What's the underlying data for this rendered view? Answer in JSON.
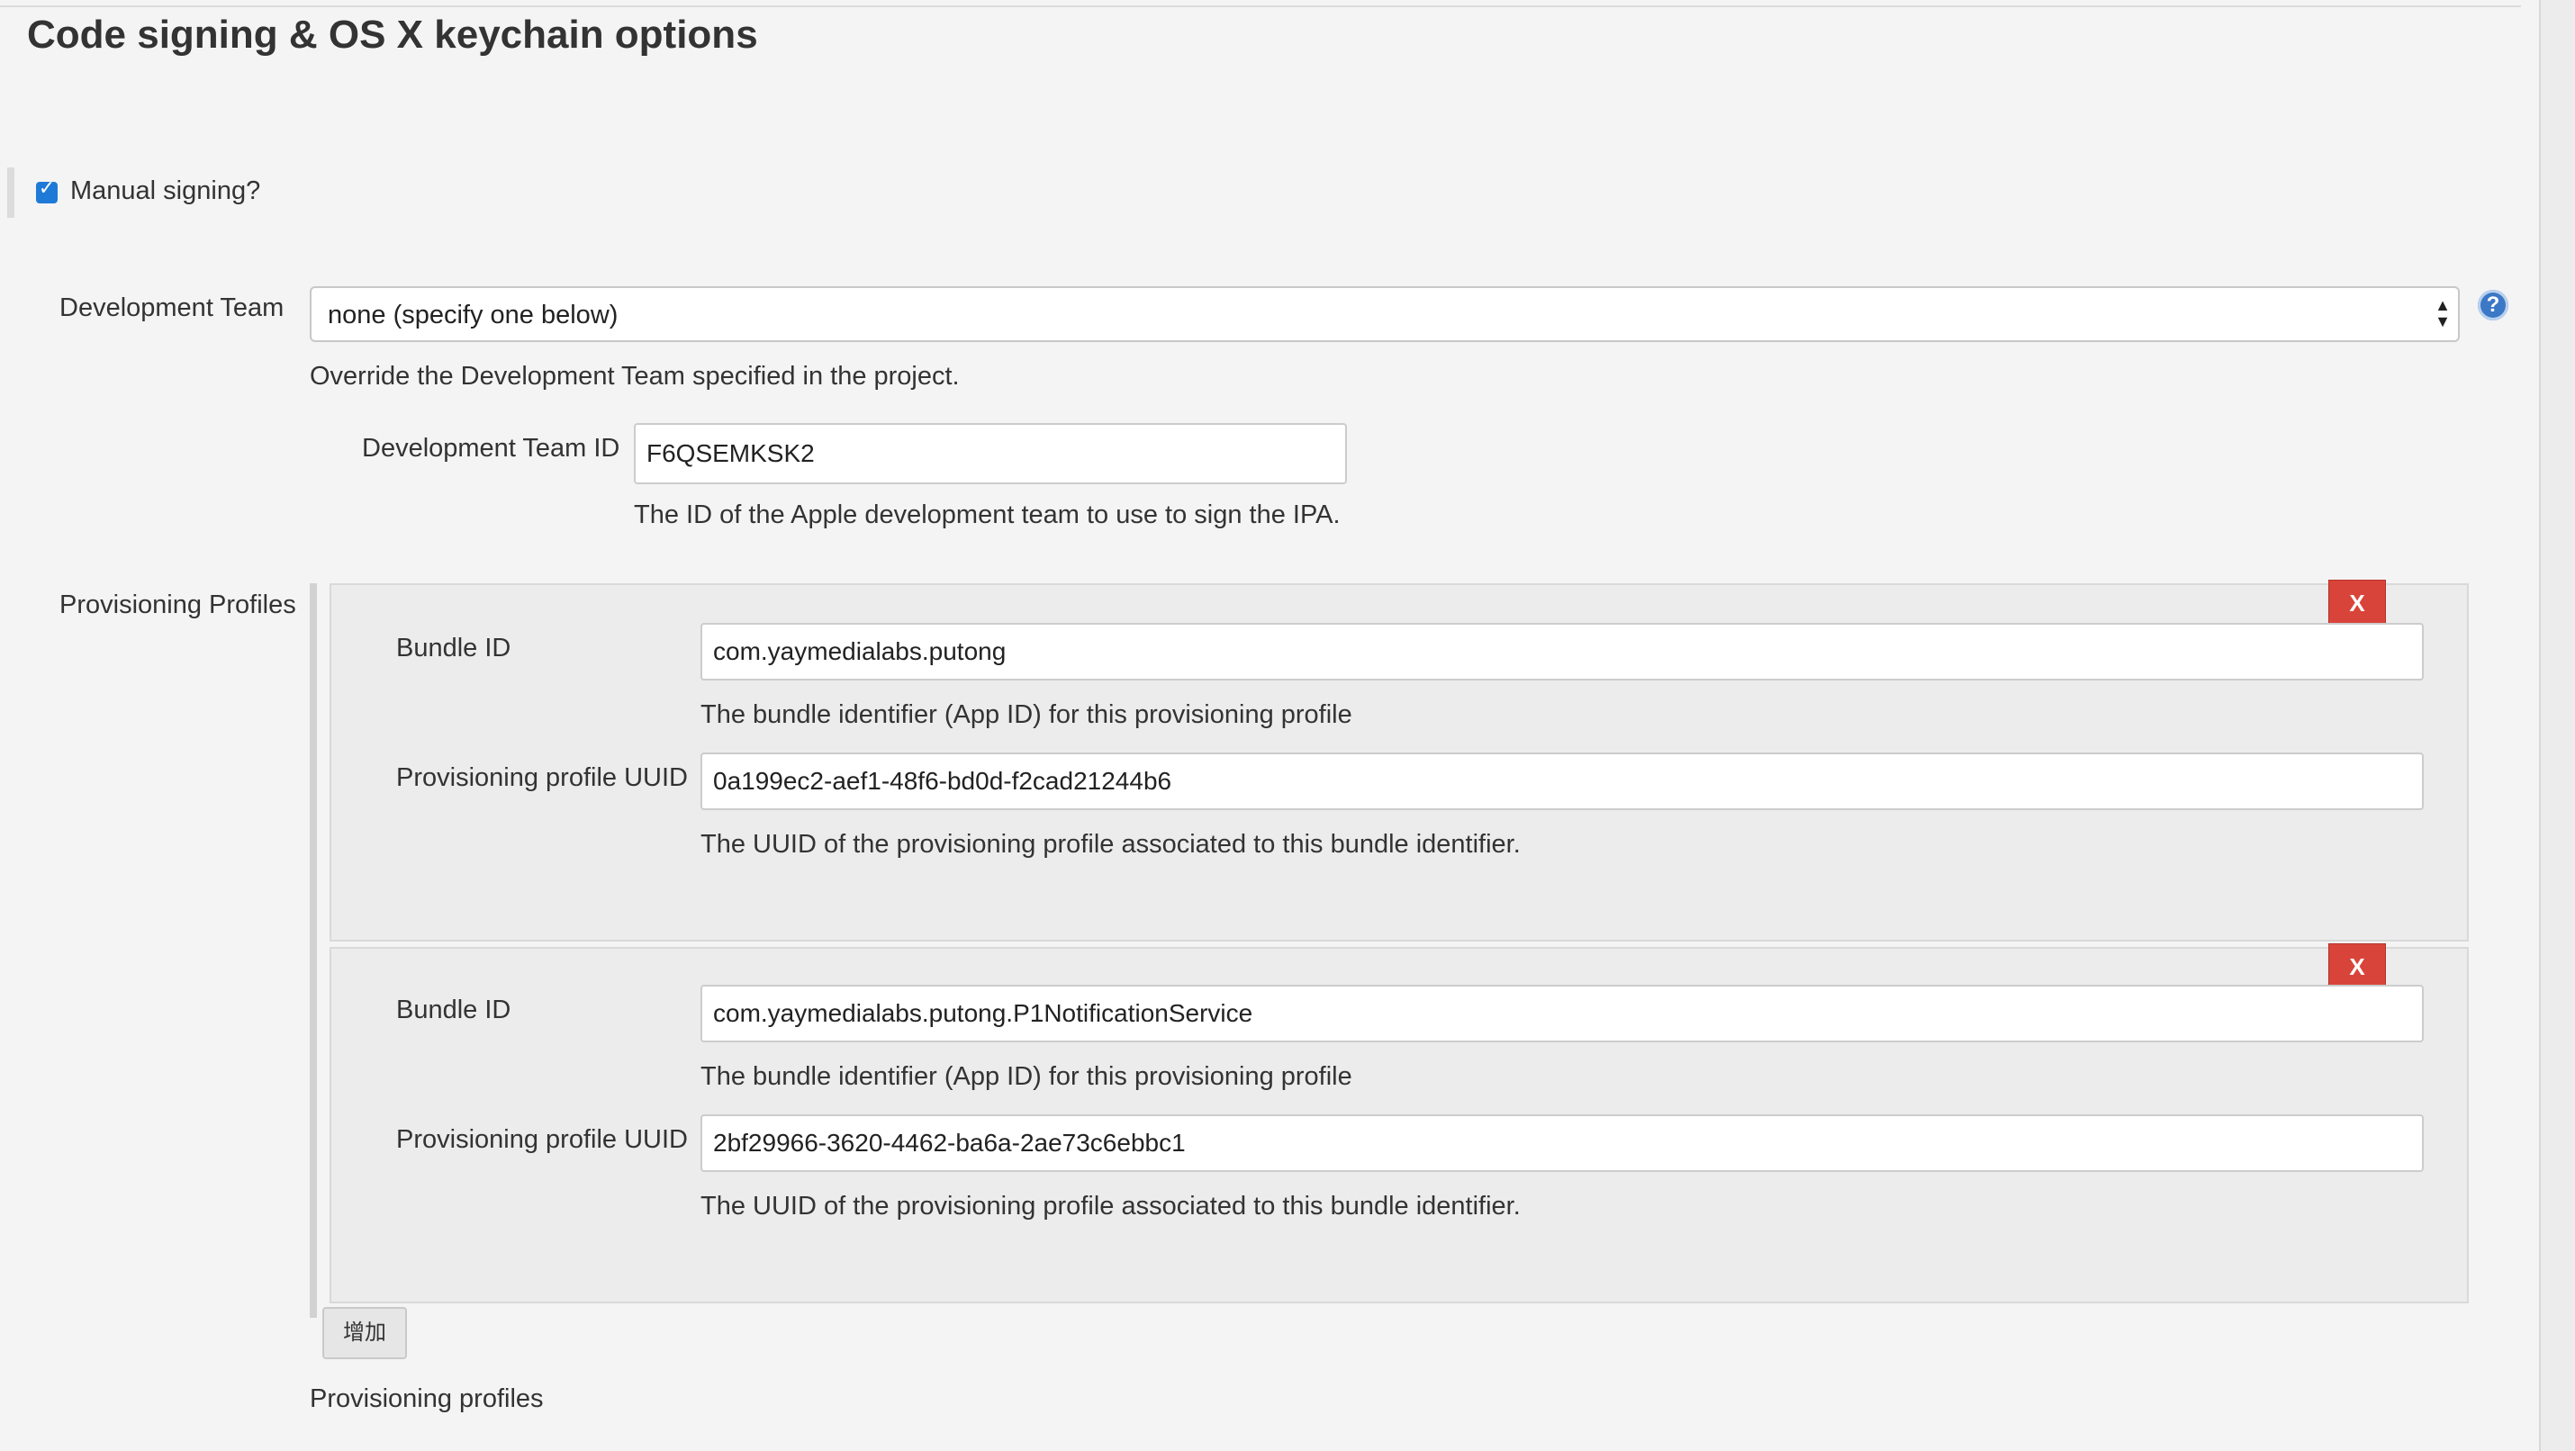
{
  "section": {
    "title": "Code signing & OS X keychain options"
  },
  "manual_signing": {
    "label": "Manual signing?",
    "checked": true
  },
  "dev_team": {
    "label": "Development Team",
    "selected": "none (specify one below)",
    "help": "Override the Development Team specified in the project."
  },
  "dev_team_id": {
    "label": "Development Team ID",
    "value": "F6QSEMKSK2",
    "help": "The ID of the Apple development team to use to sign the IPA."
  },
  "profiles": {
    "label": "Provisioning Profiles",
    "items": [
      {
        "bundle_label": "Bundle ID",
        "bundle_value": "com.yaymedialabs.putong",
        "bundle_help": "The bundle identifier (App ID) for this provisioning profile",
        "uuid_label": "Provisioning profile UUID",
        "uuid_value": "0a199ec2-aef1-48f6-bd0d-f2cad21244b6",
        "uuid_help": "The UUID of the provisioning profile associated to this bundle identifier.",
        "delete_label": "X"
      },
      {
        "bundle_label": "Bundle ID",
        "bundle_value": "com.yaymedialabs.putong.P1NotificationService",
        "bundle_help": "The bundle identifier (App ID) for this provisioning profile",
        "uuid_label": "Provisioning profile UUID",
        "uuid_value": "2bf29966-3620-4462-ba6a-2ae73c6ebbc1",
        "uuid_help": "The UUID of the provisioning profile associated to this bundle identifier.",
        "delete_label": "X"
      }
    ],
    "add_label": "增加",
    "footer_help": "Provisioning profiles"
  },
  "colors": {
    "accent": "#1f7ad7",
    "danger": "#d9443a",
    "background": "#f4f4f4",
    "card": "#ececec"
  },
  "icons": {
    "help": "question-circle-icon",
    "checkbox": "checkmark-icon",
    "select_arrows": "updown-arrows-icon"
  }
}
